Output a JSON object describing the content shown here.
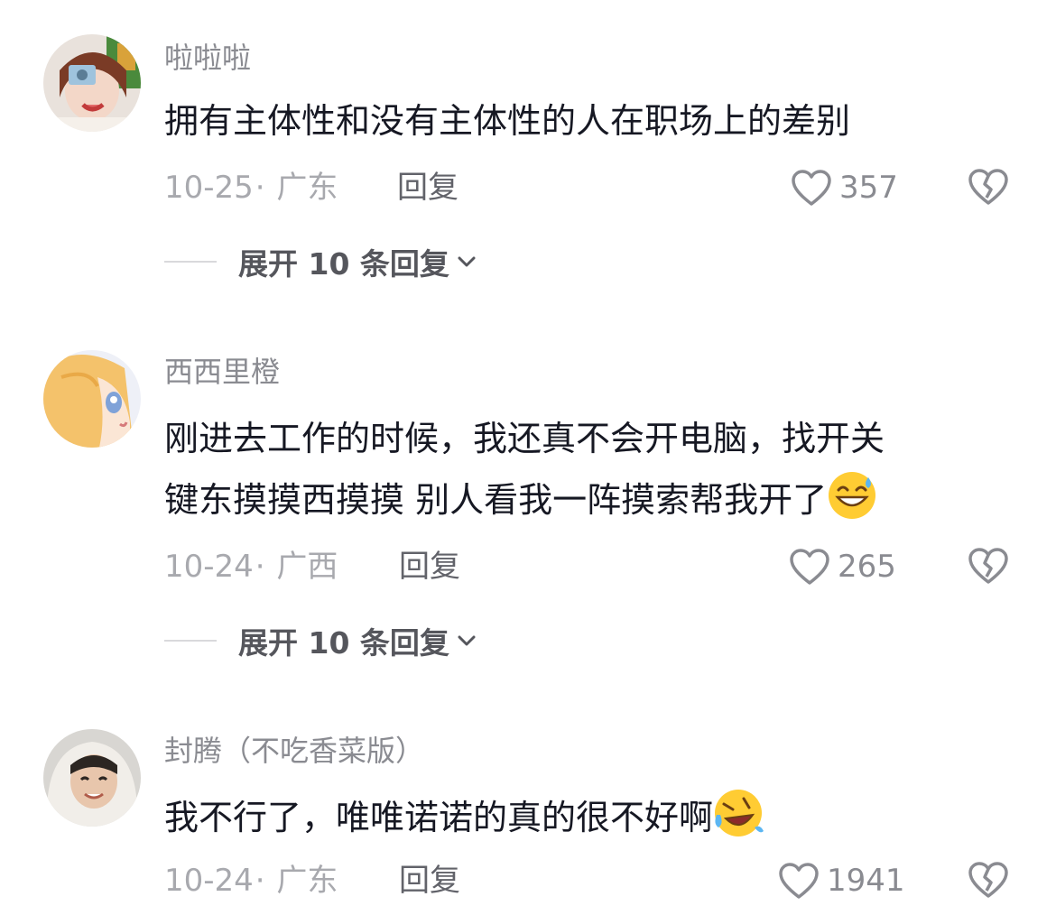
{
  "comments": [
    {
      "username": "啦啦啦",
      "text": "拥有主体性和没有主体性的人在职场上的差别",
      "date": "10-25",
      "dot": "·",
      "location": "广东",
      "reply_label": "回复",
      "likes": "357",
      "expand_label": "展开 10 条回复",
      "avatar_icon": "avatar-girl-camera"
    },
    {
      "username": "西西里橙",
      "text_line1": "刚进去工作的时候，我还真不会开电脑，找开关",
      "text_line2": "键东摸摸西摸摸 别人看我一阵摸索帮我开了",
      "emoji": "grinning-sweat-emoji",
      "date": "10-24",
      "dot": "·",
      "location": "广西",
      "reply_label": "回复",
      "likes": "265",
      "expand_label": "展开 10 条回复",
      "avatar_icon": "avatar-anime-girl"
    },
    {
      "username": "封腾（不吃香菜版）",
      "text": "我不行了，唯唯诺诺的真的很不好啊",
      "emoji": "rofl-emoji",
      "date": "10-24",
      "dot": "·",
      "location": "广东",
      "reply_label": "回复",
      "likes": "1941",
      "avatar_icon": "avatar-hoodie-person"
    }
  ],
  "colors": {
    "text": "#161823",
    "muted": "#a8a9ae",
    "username": "#8a8b91",
    "icon": "#8a8b91"
  }
}
